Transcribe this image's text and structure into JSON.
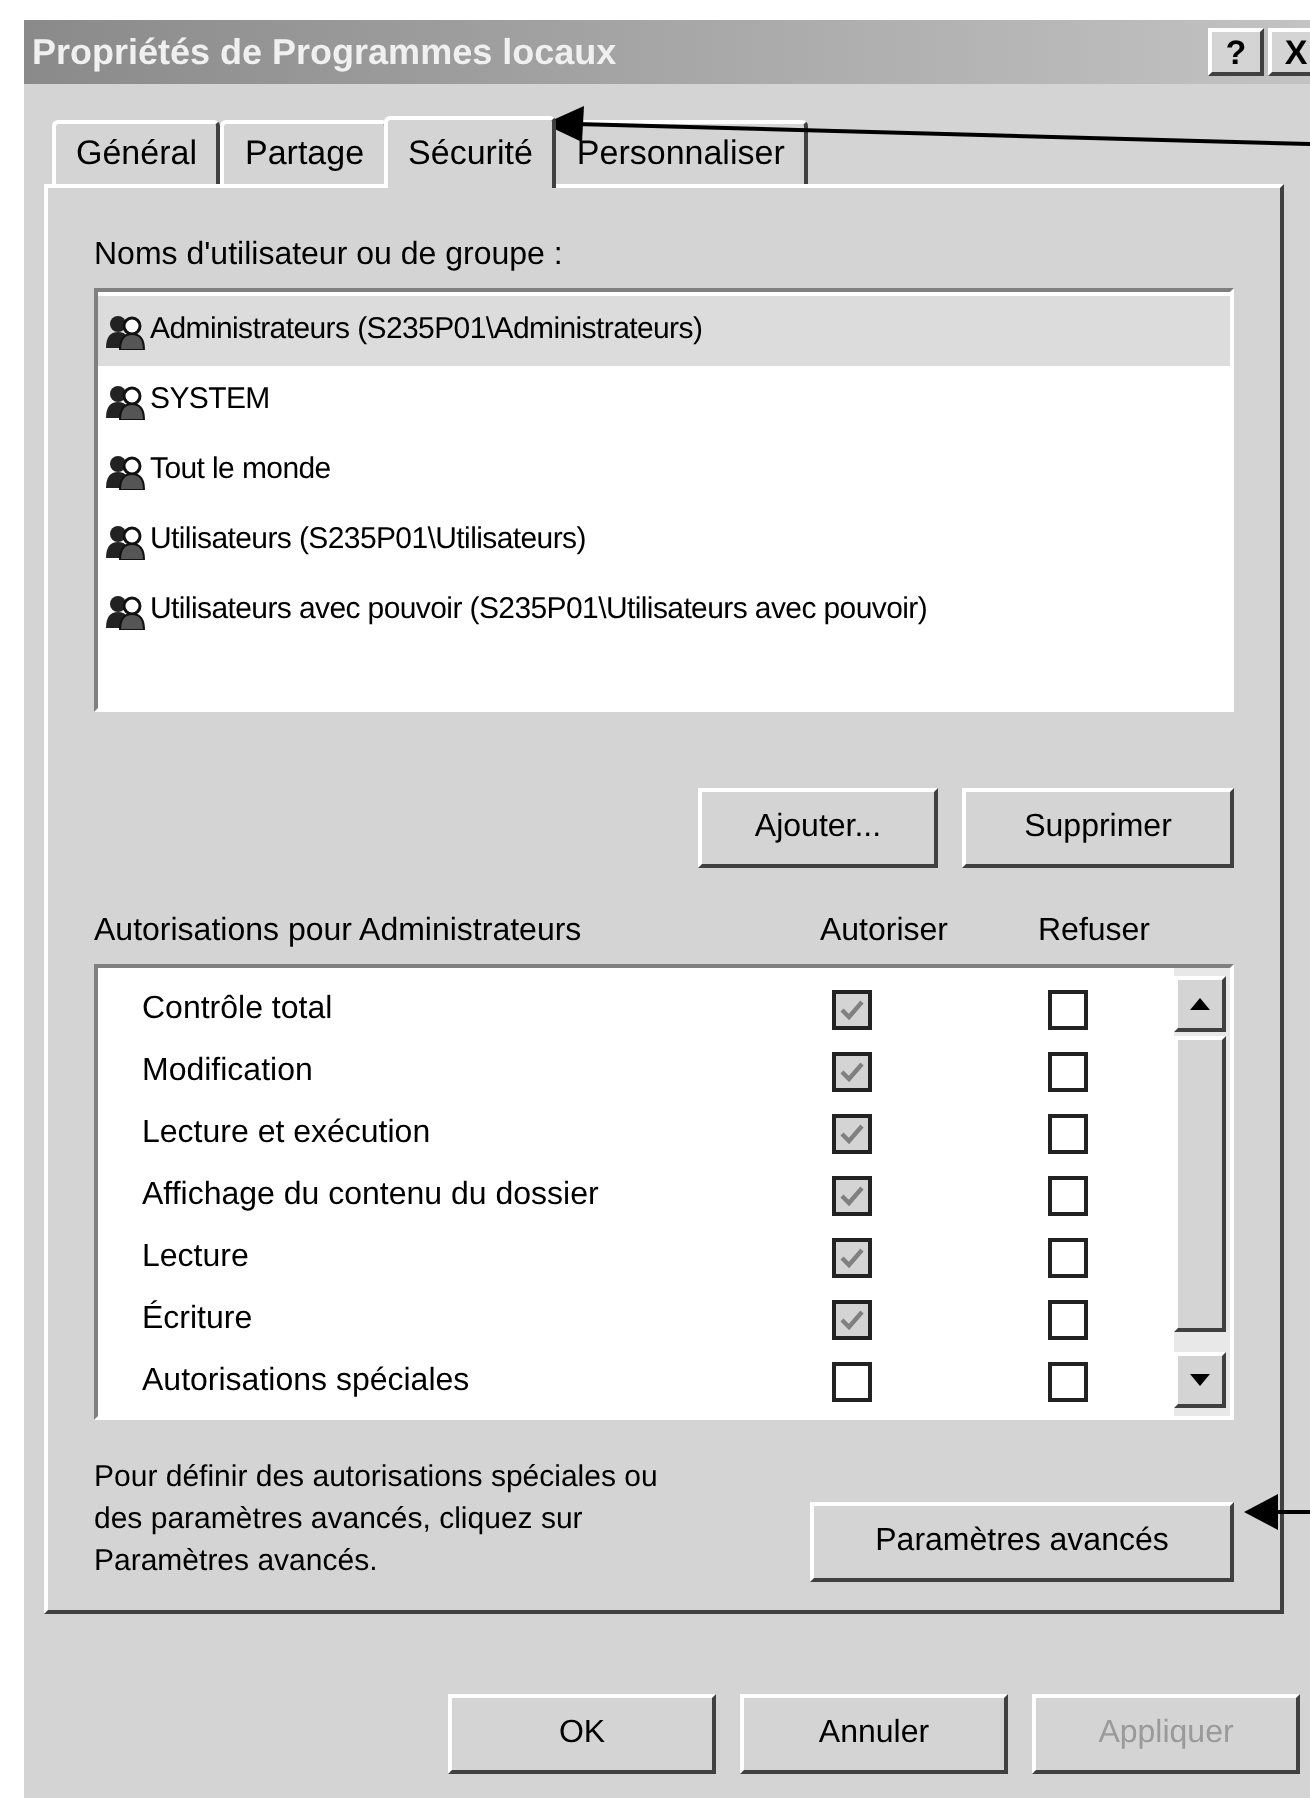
{
  "window": {
    "title": "Propriétés de Programmes locaux",
    "help_button": "?",
    "close_button": "X"
  },
  "tabs": [
    {
      "label": "Général",
      "selected": false
    },
    {
      "label": "Partage",
      "selected": false
    },
    {
      "label": "Sécurité",
      "selected": true
    },
    {
      "label": "Personnaliser",
      "selected": false
    }
  ],
  "users_label": "Noms d'utilisateur ou de groupe :",
  "users": [
    {
      "name": "Administrateurs (S235P01\\Administrateurs)",
      "selected": true
    },
    {
      "name": "SYSTEM",
      "selected": false
    },
    {
      "name": "Tout le monde",
      "selected": false
    },
    {
      "name": "Utilisateurs (S235P01\\Utilisateurs)",
      "selected": false
    },
    {
      "name": "Utilisateurs avec pouvoir (S235P01\\Utilisateurs avec pouvoir)",
      "selected": false
    }
  ],
  "user_buttons": [
    "Ajouter...",
    "Supprimer"
  ],
  "permissions_header": {
    "title": "Autorisations pour Administrateurs",
    "allow": "Autoriser",
    "deny": "Refuser"
  },
  "permissions": [
    {
      "name": "Contrôle total",
      "allow_checked": true,
      "allow_disabled": true,
      "deny_checked": false
    },
    {
      "name": "Modification",
      "allow_checked": true,
      "allow_disabled": true,
      "deny_checked": false
    },
    {
      "name": "Lecture et exécution",
      "allow_checked": true,
      "allow_disabled": true,
      "deny_checked": false
    },
    {
      "name": "Affichage du contenu du dossier",
      "allow_checked": true,
      "allow_disabled": true,
      "deny_checked": false
    },
    {
      "name": "Lecture",
      "allow_checked": true,
      "allow_disabled": true,
      "deny_checked": false
    },
    {
      "name": "Écriture",
      "allow_checked": true,
      "allow_disabled": true,
      "deny_checked": false
    },
    {
      "name": "Autorisations spéciales",
      "allow_checked": false,
      "allow_disabled": false,
      "deny_checked": false
    }
  ],
  "advanced_text": "Pour définir des autorisations spéciales ou des paramètres avancés, cliquez sur Paramètres avancés.",
  "advanced_button": "Paramètres avancés",
  "dialog_buttons": [
    {
      "label": "OK",
      "disabled": false
    },
    {
      "label": "Annuler",
      "disabled": false
    },
    {
      "label": "Appliquer",
      "disabled": true
    }
  ]
}
